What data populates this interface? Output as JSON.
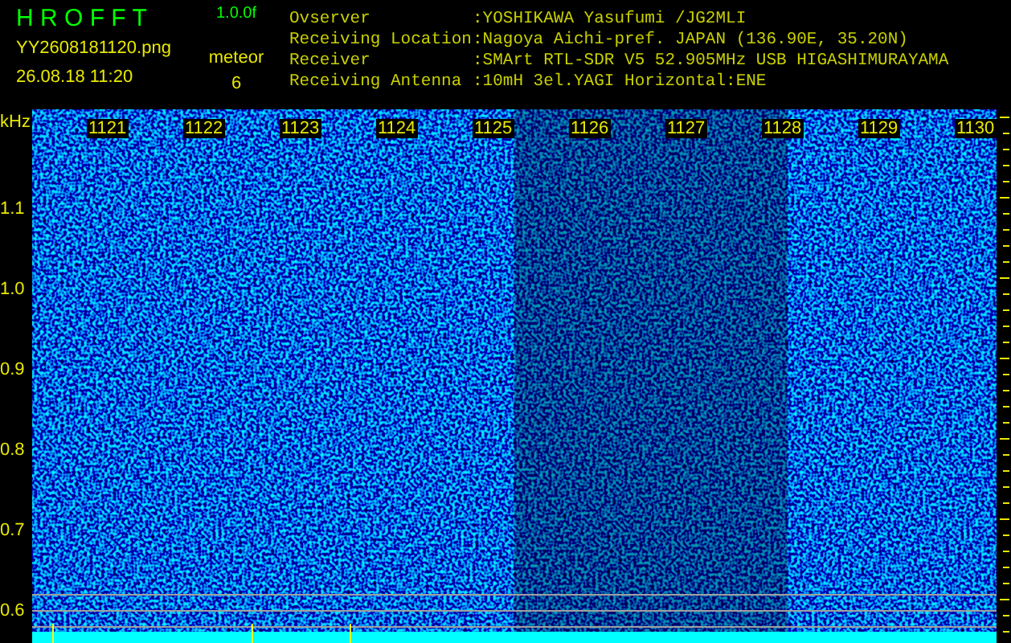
{
  "header": {
    "title": "H R O F F T",
    "version": "1.0.0f",
    "filename": "YY2608181120.png",
    "timestamp": "26.08.18 11:20",
    "detection_label": "meteor",
    "detection_count": "6"
  },
  "station_info": [
    {
      "label": "Ovserver",
      "value": ":YOSHIKAWA Yasufumi /JG2MLI"
    },
    {
      "label": "Receiving Location",
      "value": ":Nagoya Aichi-pref. JAPAN (136.90E, 35.20N)"
    },
    {
      "label": "Receiver",
      "value": ":SMArt RTL-SDR V5 52.905MHz USB HIGASHIMURAYAMA"
    },
    {
      "label": "Receiving Antenna",
      "value": ":10mH 3el.YAGI Horizontal:ENE"
    }
  ],
  "spectrogram": {
    "y_unit": "kHz",
    "x_ticks": [
      "1121",
      "1122",
      "1123",
      "1124",
      "1125",
      "1126",
      "1127",
      "1128",
      "1129",
      "1130"
    ],
    "y_ticks": [
      "1.1",
      "1.0",
      "0.9",
      "0.8",
      "0.7",
      "0.6"
    ]
  }
}
